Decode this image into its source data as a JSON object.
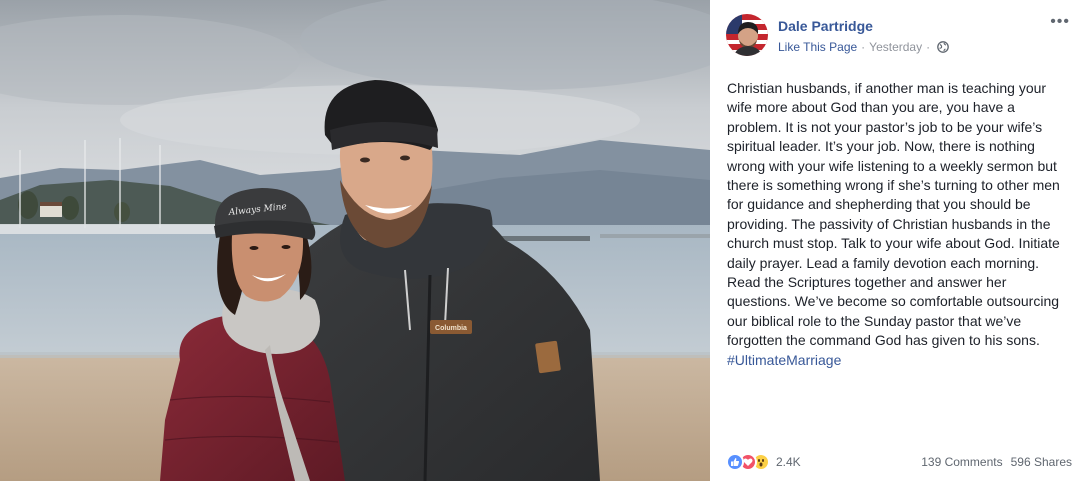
{
  "post": {
    "author": "Dale Partridge",
    "like_page": "Like This Page",
    "separator": "·",
    "time": "Yesterday",
    "separator2": "·",
    "more": "•••",
    "text": "Christian husbands, if another man is teaching your wife more about God than you are, you have a problem. It is not your pastor’s job to be your wife’s spiritual leader. It’s your job. Now, there is nothing wrong with your wife listening to a weekly sermon but there is something wrong if she’s turning to other men for guidance and shepherding that you should be providing. The passivity of Christian husbands in the church must stop. Talk to your wife about God. Initiate daily prayer. Lead a family devotion each morning. Read the Scriptures together and answer her questions. We’ve become so comfortable outsourcing our biblical role to the Sunday pastor that we’ve forgotten the command God has given to his sons.",
    "hashtag": "#UltimateMarriage"
  },
  "photo": {
    "hat_text": "Always Mine",
    "jacket_brand": "Columbia"
  },
  "footer": {
    "reactions": [
      "like-icon",
      "love-icon",
      "wow-icon"
    ],
    "reaction_count": "2.4K",
    "comments": "139 Comments",
    "shares": "596 Shares"
  },
  "colors": {
    "link": "#385898",
    "meta": "#90949c",
    "like": "#5890ff",
    "love": "#f25268",
    "wow": "#fcd046"
  }
}
